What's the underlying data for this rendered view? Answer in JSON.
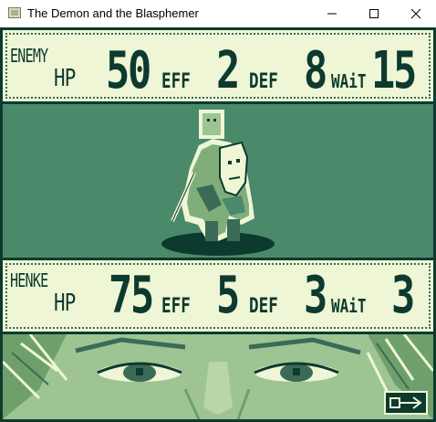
{
  "window": {
    "title": "The Demon and the Blasphemer"
  },
  "enemy": {
    "name": "ENEMY",
    "hp_label": "HP",
    "hp": "50",
    "eff_label": "EFF",
    "eff": "2",
    "def_label": "DEF",
    "def": "8",
    "wait_label": "WAiT",
    "wait": "15"
  },
  "player": {
    "name": "HENKE",
    "hp_label": "HP",
    "hp": "75",
    "eff_label": "EFF",
    "eff": "5",
    "def_label": "DEF",
    "def": "3",
    "wait_label": "WAiT",
    "wait": "3"
  },
  "controls": {
    "next_icon": "arrow-right-icon"
  },
  "palette": {
    "darkest": "#0d3a2e",
    "dark": "#3b6b57",
    "mid": "#4a8a6a",
    "light": "#9ec494",
    "lightest": "#eef6d6"
  }
}
